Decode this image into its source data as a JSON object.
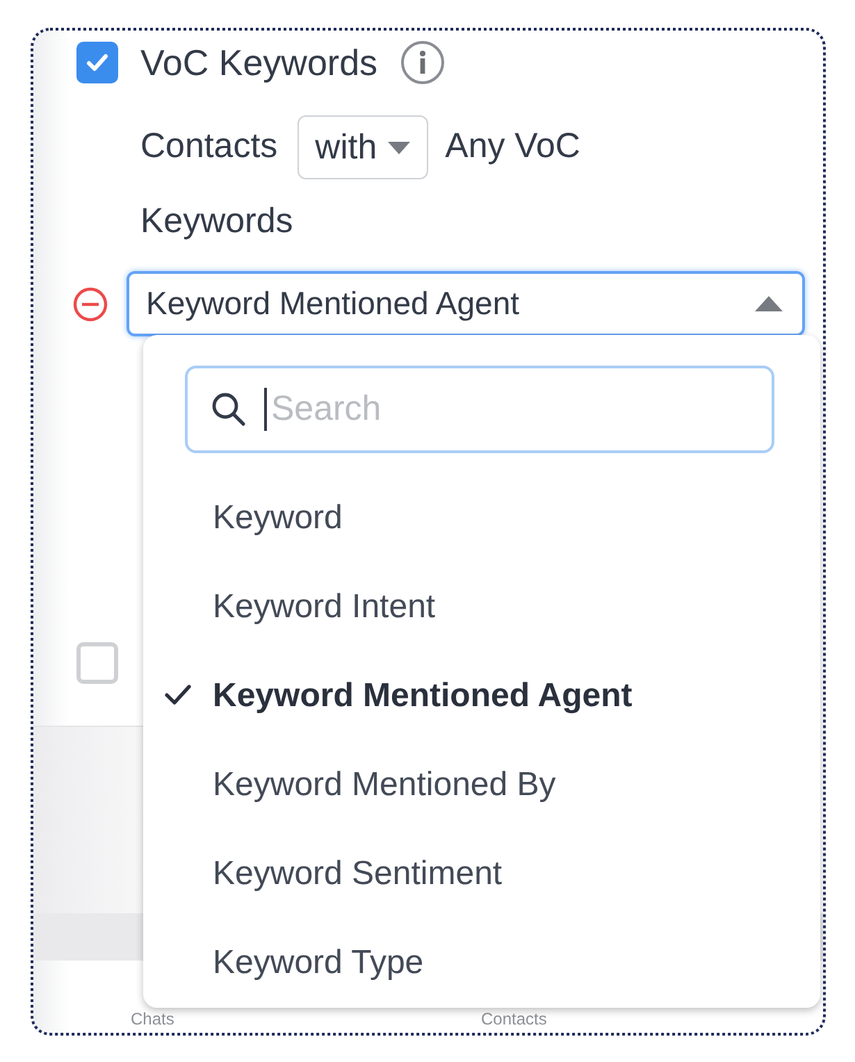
{
  "filter": {
    "label": "VoC Keywords",
    "checked": true
  },
  "condition": {
    "prefix": "Contacts",
    "operator": "with",
    "suffix": "Any VoC",
    "suffix_continued": "Keywords"
  },
  "field_select": {
    "value": "Keyword Mentioned Agent",
    "expanded": true
  },
  "dropdown": {
    "search_placeholder": "Search",
    "options": [
      {
        "label": "Keyword",
        "selected": false
      },
      {
        "label": "Keyword Intent",
        "selected": false
      },
      {
        "label": "Keyword Mentioned Agent",
        "selected": true
      },
      {
        "label": "Keyword Mentioned By",
        "selected": false
      },
      {
        "label": "Keyword Sentiment",
        "selected": false
      },
      {
        "label": "Keyword Type",
        "selected": false
      }
    ]
  },
  "second_filter": {
    "checked": false
  },
  "footer_tabs": [
    {
      "label": "Chats"
    },
    {
      "label": "Contacts"
    }
  ]
}
